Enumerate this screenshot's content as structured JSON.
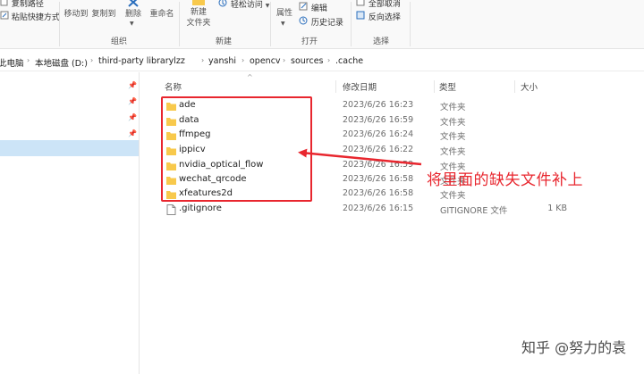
{
  "ribbon": {
    "clipboard": {
      "copy_path": "复制路径",
      "paste_shortcut": "粘贴快捷方式",
      "move_to": "移动到",
      "copy_to": "复制到",
      "group_label": "组织"
    },
    "organize": {
      "delete": "删除",
      "rename": "重命名",
      "group_label": "组织"
    },
    "new": {
      "new_folder": "新建\n文件夹",
      "new_folder_l1": "新建",
      "new_folder_l2": "文件夹",
      "easy_access": "轻松访问",
      "group_label": "新建"
    },
    "open": {
      "properties": "属性",
      "edit": "编辑",
      "history": "历史记录",
      "group_label": "打开"
    },
    "select": {
      "select_none": "全部取消",
      "invert_selection": "反向选择",
      "group_label": "选择"
    }
  },
  "address": {
    "crumbs": [
      "此电脑",
      "本地磁盘 (D:)",
      "third-party librarylzz",
      "yanshi",
      "opencv",
      "sources",
      ".cache"
    ]
  },
  "columns": {
    "name": "名称",
    "date": "修改日期",
    "type": "类型",
    "size": "大小"
  },
  "files": [
    {
      "name": "ade",
      "date": "2023/6/26 16:23",
      "type": "文件夹",
      "size": "",
      "kind": "folder"
    },
    {
      "name": "data",
      "date": "2023/6/26 16:59",
      "type": "文件夹",
      "size": "",
      "kind": "folder"
    },
    {
      "name": "ffmpeg",
      "date": "2023/6/26 16:24",
      "type": "文件夹",
      "size": "",
      "kind": "folder"
    },
    {
      "name": "ippicv",
      "date": "2023/6/26 16:22",
      "type": "文件夹",
      "size": "",
      "kind": "folder"
    },
    {
      "name": "nvidia_optical_flow",
      "date": "2023/6/26 16:59",
      "type": "文件夹",
      "size": "",
      "kind": "folder"
    },
    {
      "name": "wechat_qrcode",
      "date": "2023/6/26 16:58",
      "type": "文件夹",
      "size": "",
      "kind": "folder"
    },
    {
      "name": "xfeatures2d",
      "date": "2023/6/26 16:58",
      "type": "文件夹",
      "size": "",
      "kind": "folder"
    },
    {
      "name": ".gitignore",
      "date": "2023/6/26 16:15",
      "type": "GITIGNORE 文件",
      "size": "1 KB",
      "kind": "file"
    }
  ],
  "annotation": {
    "text": "将里面的缺失文件补上",
    "color": "#e8262e"
  },
  "watermark": "知乎 @努力的袁",
  "colors": {
    "folder": "#f8c94c",
    "selection": "#cce4f7",
    "annotation": "#e8262e"
  }
}
